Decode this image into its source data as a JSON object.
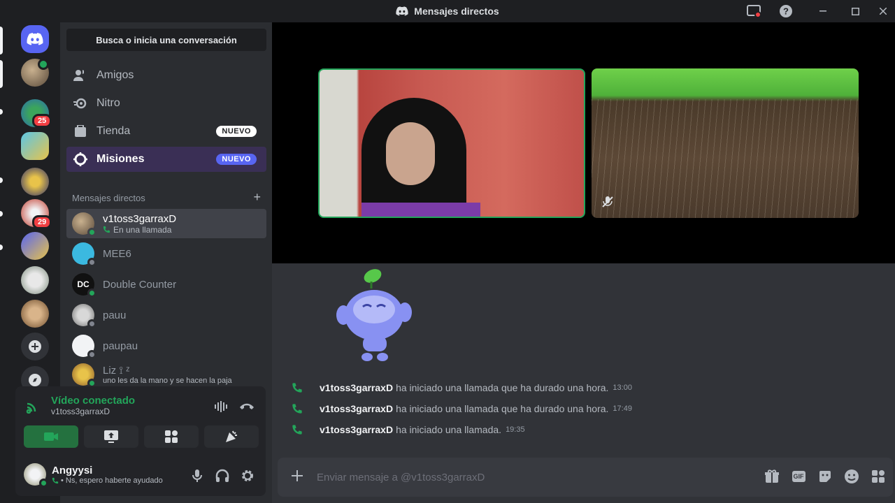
{
  "window": {
    "title": "Mensajes directos"
  },
  "search": {
    "label": "Busca o inicia una conversación"
  },
  "nav": [
    {
      "label": "Amigos"
    },
    {
      "label": "Nitro"
    },
    {
      "label": "Tienda",
      "badge": "NUEVO"
    },
    {
      "label": "Misiones",
      "badge": "NUEVO"
    }
  ],
  "dm_header": {
    "label": "Mensajes directos",
    "add": "+"
  },
  "dms": [
    {
      "name": "v1toss3garraxD",
      "sub": "En una llamada"
    },
    {
      "name": "MEE6"
    },
    {
      "name": "Double Counter",
      "avatar_text": "DC"
    },
    {
      "name": "pauu"
    },
    {
      "name": "paupau"
    },
    {
      "name": "Liz ⟟ ᶻ",
      "sub": "uno les da la mano y se hacen la paja"
    }
  ],
  "servers": {
    "badges": [
      "25",
      "29"
    ]
  },
  "voice": {
    "status": "Vídeo conectado",
    "channel": "v1toss3garraxD"
  },
  "user": {
    "name": "Angyysi",
    "status": "• Ns, espero haberte ayudado"
  },
  "messages": [
    {
      "who": "v1toss3garraxD",
      "text": "ha iniciado una llamada que ha durado una hora.",
      "time": "13:00"
    },
    {
      "who": "v1toss3garraxD",
      "text": "ha iniciado una llamada que ha durado una hora.",
      "time": "17:49"
    },
    {
      "who": "v1toss3garraxD",
      "text": "ha iniciado una llamada.",
      "time": "19:35"
    }
  ],
  "composer": {
    "placeholder": "Enviar mensaje a @v1toss3garraxD",
    "gif_label": "GIF"
  },
  "colors": {
    "brand": "#5865f2",
    "online": "#23a55a",
    "danger": "#f23f43"
  }
}
